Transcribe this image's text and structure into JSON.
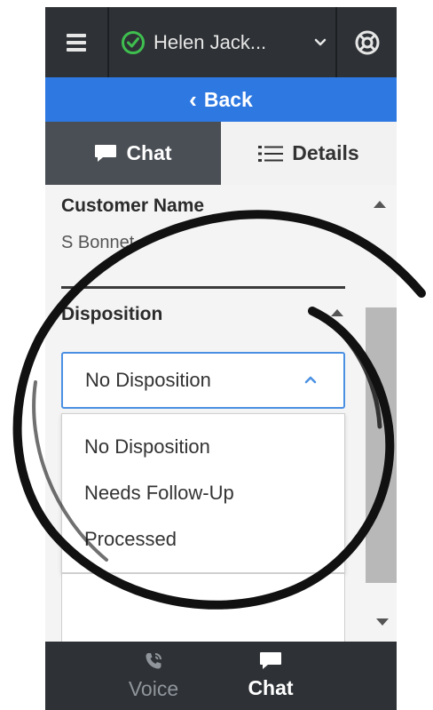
{
  "header": {
    "user_name": "Helen Jack...",
    "status_color": "#3fbf4f",
    "icons": [
      "hamburger-icon",
      "check-circle-icon",
      "chevron-down-icon",
      "support-icon"
    ]
  },
  "back_bar": {
    "label": "Back",
    "color": "#2d78e1"
  },
  "tabs": [
    {
      "label": "Chat",
      "icon": "chat-bubble-icon",
      "active": true
    },
    {
      "label": "Details",
      "icon": "list-icon",
      "active": false
    }
  ],
  "customer": {
    "title": "Customer Name",
    "value": "S Bonnet"
  },
  "disposition": {
    "title": "Disposition",
    "selected": "No Disposition",
    "options": [
      "No Disposition",
      "Needs Follow-Up",
      "Processed"
    ]
  },
  "bottom_nav": [
    {
      "label": "Voice",
      "icon": "phone-icon",
      "active": false
    },
    {
      "label": "Chat",
      "icon": "chat-bubble-icon",
      "active": true
    }
  ]
}
